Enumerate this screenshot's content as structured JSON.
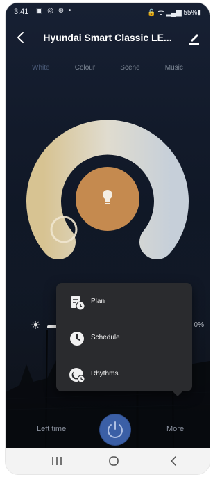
{
  "status": {
    "time": "3:41",
    "left_icons": "▣ ◎ ⊕ •",
    "right_icons": "🔒 ᯤ ▂▄▆ 55%▮"
  },
  "header": {
    "title": "Hyundai Smart Classic LE..."
  },
  "tabs": [
    {
      "label": "White",
      "active": true
    },
    {
      "label": "Colour",
      "active": false
    },
    {
      "label": "Scene",
      "active": false
    },
    {
      "label": "Music",
      "active": false
    }
  ],
  "brightness": {
    "percent_label": "0%",
    "level": 0.1
  },
  "menu": {
    "items": [
      {
        "label": "Plan",
        "icon": "plan-icon"
      },
      {
        "label": "Schedule",
        "icon": "schedule-icon"
      },
      {
        "label": "Rhythms",
        "icon": "rhythms-icon"
      }
    ]
  },
  "bottom": {
    "left_time_label": "Left time",
    "more_label": "More"
  },
  "colors": {
    "warm": "#d6c49a",
    "cool": "#cbd3dc",
    "center": "#c58a4f",
    "accent": "#3b5fa6",
    "menu_bg": "#2a2b2e"
  }
}
